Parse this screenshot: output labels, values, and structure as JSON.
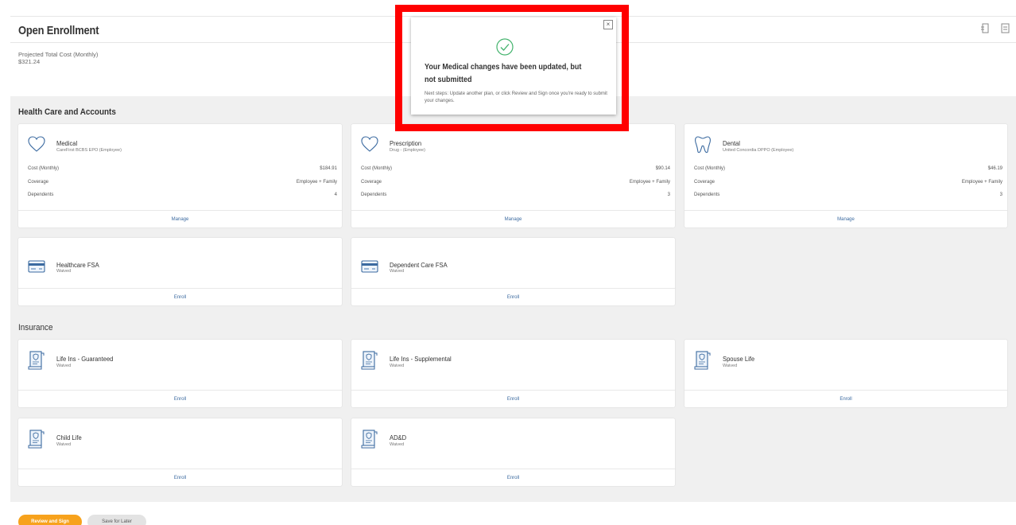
{
  "header": {
    "title": "Open Enrollment"
  },
  "projected": {
    "label": "Projected Total Cost (Monthly)",
    "value": "$321.24"
  },
  "sections": {
    "health": "Health Care and Accounts",
    "insurance": "Insurance"
  },
  "medical": {
    "title": "Medical",
    "subtitle": "CareFirst BCBS EPO (Employee)",
    "cost_label": "Cost (Monthly)",
    "cost": "$184.91",
    "coverage_label": "Coverage",
    "coverage": "Employee + Family",
    "dependents_label": "Dependents",
    "dependents": "4",
    "action": "Manage"
  },
  "prescription": {
    "title": "Prescription",
    "subtitle": "Drug - (Employee)",
    "cost_label": "Cost (Monthly)",
    "cost": "$90.14",
    "coverage_label": "Coverage",
    "coverage": "Employee + Family",
    "dependents_label": "Dependents",
    "dependents": "3",
    "action": "Manage"
  },
  "dental": {
    "title": "Dental",
    "subtitle": "United Concordia DPPO (Employee)",
    "cost_label": "Cost (Monthly)",
    "cost": "$46.19",
    "coverage_label": "Coverage",
    "coverage": "Employee + Family",
    "dependents_label": "Dependents",
    "dependents": "3",
    "action": "Manage"
  },
  "hcfsa": {
    "title": "Healthcare FSA",
    "subtitle": "Waived",
    "action": "Enroll"
  },
  "dcfsa": {
    "title": "Dependent Care FSA",
    "subtitle": "Waived",
    "action": "Enroll"
  },
  "life_g": {
    "title": "Life Ins - Guaranteed",
    "subtitle": "Waived",
    "action": "Enroll"
  },
  "life_s": {
    "title": "Life Ins - Supplemental",
    "subtitle": "Waived",
    "action": "Enroll"
  },
  "spouse": {
    "title": "Spouse Life",
    "subtitle": "Waived",
    "action": "Enroll"
  },
  "child": {
    "title": "Child Life",
    "subtitle": "Waived",
    "action": "Enroll"
  },
  "add": {
    "title": "AD&D",
    "subtitle": "Waived",
    "action": "Enroll"
  },
  "buttons": {
    "review": "Review and Sign",
    "save": "Save for Later"
  },
  "toast": {
    "close": "×",
    "title": "Your Medical changes have been updated, but not submitted",
    "message": "Next steps: Update another plan, or click Review and Sign once you're ready to submit your changes."
  },
  "colors": {
    "accent": "#f7a21c",
    "link": "#3b6aa0",
    "highlight": "#ff0000",
    "success": "#43b36d"
  },
  "icons": {
    "heart": "heart-icon",
    "tooth": "tooth-icon",
    "card": "credit-card-icon",
    "policy": "policy-document-icon",
    "check": "check-circle-icon"
  }
}
